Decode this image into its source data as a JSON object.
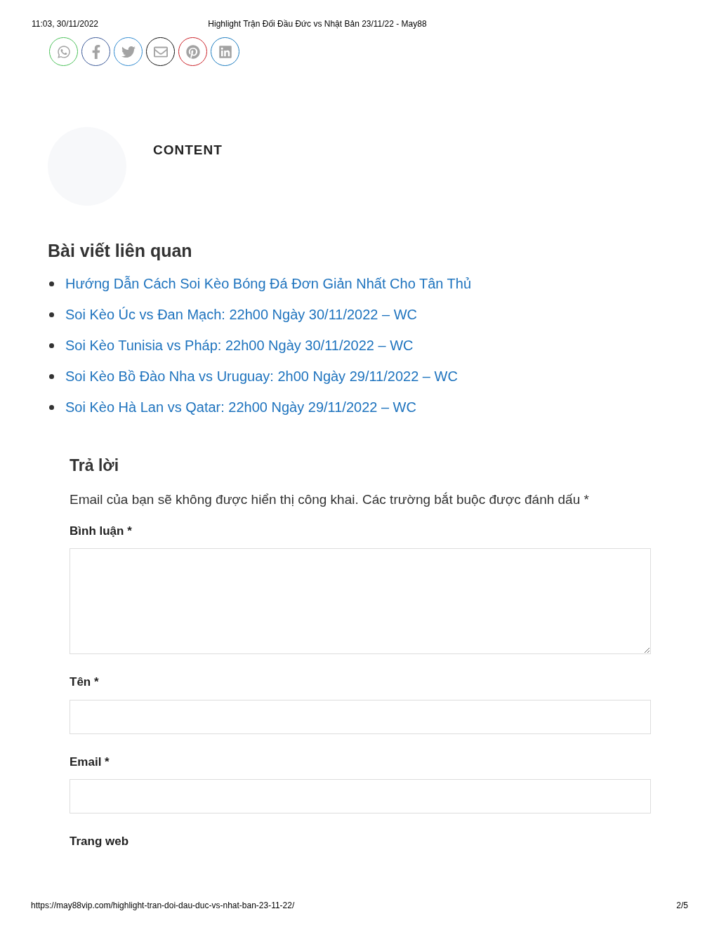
{
  "print_header": {
    "datetime": "11:03, 30/11/2022",
    "title": "Highlight Trận Đối Đầu Đức vs Nhật Bản 23/11/22 - May88"
  },
  "share_buttons": [
    {
      "kind": "whatsapp",
      "color": "#4cc25a"
    },
    {
      "kind": "facebook",
      "color": "#3b5998"
    },
    {
      "kind": "twitter",
      "color": "#2f8ad0"
    },
    {
      "kind": "email",
      "color": "#111111"
    },
    {
      "kind": "pinterest",
      "color": "#cb2027"
    },
    {
      "kind": "linkedin",
      "color": "#1a7bbf"
    }
  ],
  "author_box": {
    "label": "CONTENT"
  },
  "related_posts": {
    "heading": "Bài viết liên quan",
    "items": [
      "Hướng Dẫn Cách Soi Kèo Bóng Đá Đơn Giản Nhất Cho Tân Thủ",
      "Soi Kèo Úc vs Đan Mạch: 22h00 Ngày 30/11/2022 – WC",
      "Soi Kèo Tunisia vs Pháp: 22h00 Ngày 30/11/2022 – WC",
      "Soi Kèo Bồ Đào Nha vs Uruguay: 2h00 Ngày 29/11/2022 – WC",
      "Soi Kèo Hà Lan vs Qatar: 22h00 Ngày 29/11/2022 – WC"
    ]
  },
  "reply_form": {
    "heading": "Trả lời",
    "notice": "Email của bạn sẽ không được hiển thị công khai. Các trường bắt buộc được đánh dấu *",
    "fields": [
      {
        "label": "Bình luận *",
        "kind": "textarea"
      },
      {
        "label": "Tên *",
        "kind": "input"
      },
      {
        "label": "Email *",
        "kind": "input"
      },
      {
        "label": "Trang web",
        "kind": "label_only"
      }
    ]
  },
  "print_footer": {
    "url": "https://may88vip.com/highlight-tran-doi-dau-duc-vs-nhat-ban-23-11-22/",
    "page": "2/5"
  }
}
